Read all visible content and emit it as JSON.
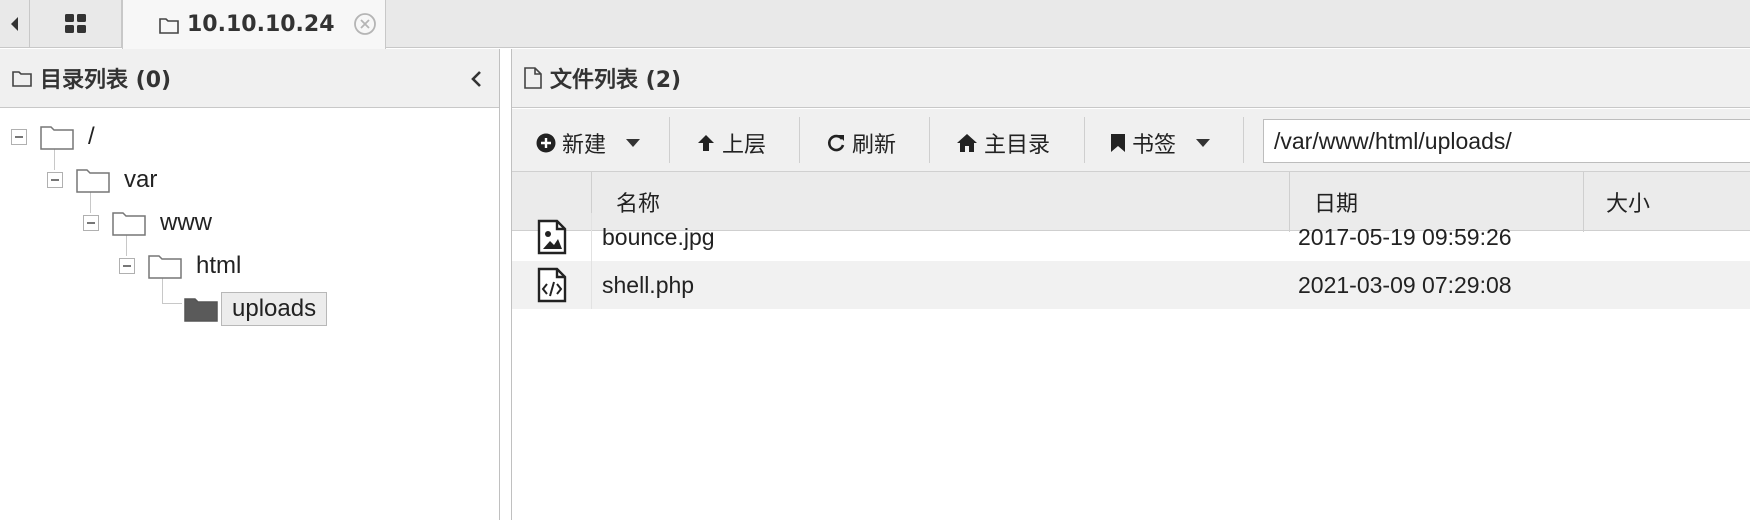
{
  "tabbar": {
    "active_tab": "10.10.10.24"
  },
  "dir_panel": {
    "title": "目录列表 (0)",
    "tree": [
      "/",
      "var",
      "www",
      "html",
      "uploads"
    ]
  },
  "file_panel": {
    "title": "文件列表 (2)",
    "toolbar": {
      "new_label": "新建",
      "up_label": "上层",
      "refresh_label": "刷新",
      "home_label": "主目录",
      "bookmark_label": "书签"
    },
    "path": "/var/www/html/uploads/",
    "columns": {
      "name": "名称",
      "date": "日期",
      "size": "大小"
    },
    "files": [
      {
        "name": "bounce.jpg",
        "date": "2017-05-19 09:59:26",
        "icon": "image-file-icon"
      },
      {
        "name": "shell.php",
        "date": "2021-03-09 07:29:08",
        "icon": "code-file-icon"
      }
    ]
  }
}
